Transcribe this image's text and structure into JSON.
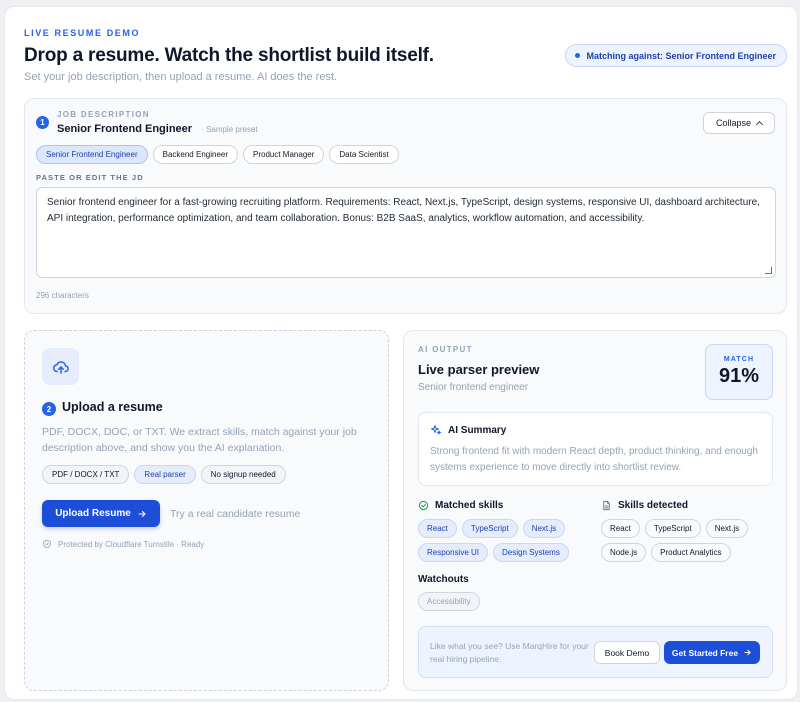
{
  "header": {
    "eyebrow": "LIVE RESUME DEMO",
    "title": "Drop a resume. Watch the shortlist build itself.",
    "subtitle": "Set your job description, then upload a resume. AI does the rest.",
    "matching_pill": "Matching against: Senior Frontend Engineer"
  },
  "jd": {
    "step": "1",
    "label": "JOB DESCRIPTION",
    "title": "Senior Frontend Engineer",
    "preset_note": "· Sample preset",
    "collapse_label": "Collapse",
    "presets": [
      "Senior Frontend Engineer",
      "Backend Engineer",
      "Product Manager",
      "Data Scientist"
    ],
    "paste_label": "PASTE OR EDIT THE JD",
    "text": "Senior frontend engineer for a fast-growing recruiting platform. Requirements: React, Next.js, TypeScript, design systems, responsive UI, dashboard architecture, API integration, performance optimization, and team collaboration. Bonus: B2B SaaS, analytics, workflow automation, and accessibility.",
    "char_count": "296 characters"
  },
  "upload": {
    "step": "2",
    "title": "Upload a resume",
    "description": "PDF, DOCX, DOC, or TXT. We extract skills, match against your job description above, and show you the AI explanation.",
    "chips": [
      "PDF / DOCX / TXT",
      "Real parser",
      "No signup needed"
    ],
    "button_label": "Upload Resume",
    "hint": "Try a real candidate resume",
    "protection": "Protected by Cloudflare Turnstile · Ready"
  },
  "ai": {
    "label": "AI OUTPUT",
    "title": "Live parser preview",
    "subtitle": "Senior frontend engineer",
    "match_label": "MATCH",
    "match_value": "91%",
    "summary_title": "AI Summary",
    "summary_text": "Strong frontend fit with modern React depth, product thinking, and enough systems experience to move directly into shortlist review.",
    "matched_title": "Matched skills",
    "matched": [
      "React",
      "TypeScript",
      "Next.js",
      "Responsive UI",
      "Design Systems"
    ],
    "detected_title": "Skills detected",
    "detected": [
      "React",
      "TypeScript",
      "Next.js",
      "Node.js",
      "Product Analytics"
    ],
    "watch_title": "Watchouts",
    "watchouts": [
      "Accessibility"
    ],
    "cta_text": "Like what you see? Use MarqHire for your real hiring pipeline.",
    "demo_button": "Book Demo",
    "start_button": "Get Started Free"
  },
  "colors": {
    "accent": "#2563eb",
    "button": "#1d4ed8",
    "match_green": "#16a34a"
  }
}
